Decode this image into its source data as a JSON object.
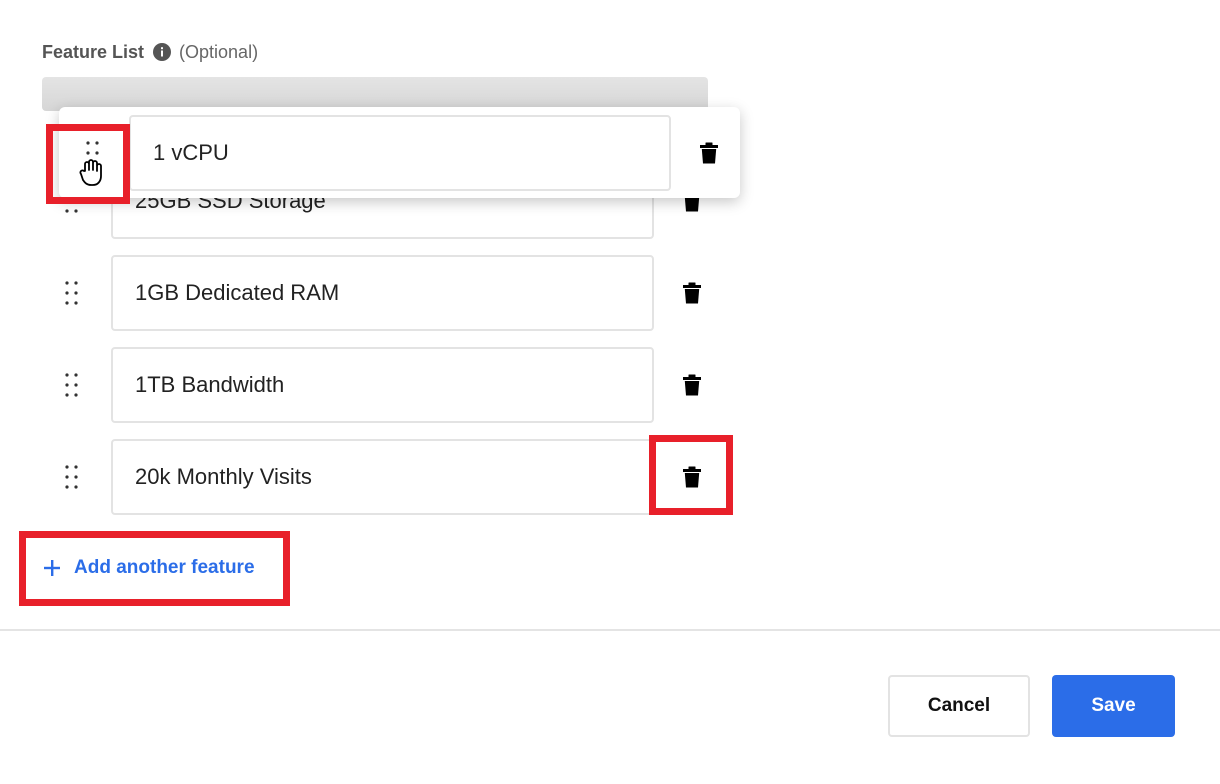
{
  "feature_list": {
    "label": "Feature List",
    "optional_text": "(Optional)",
    "info_icon": "info-circle-icon"
  },
  "dragging_item": {
    "value": "1 vCPU"
  },
  "items": [
    {
      "value": "25GB SSD Storage"
    },
    {
      "value": "1GB Dedicated RAM"
    },
    {
      "value": "1TB Bandwidth"
    },
    {
      "value": "20k Monthly Visits"
    }
  ],
  "add_button": {
    "label": "Add another feature",
    "icon": "plus-icon"
  },
  "footer": {
    "cancel_label": "Cancel",
    "save_label": "Save"
  },
  "colors": {
    "accent": "#2b6de8",
    "highlight": "#e8202a"
  }
}
